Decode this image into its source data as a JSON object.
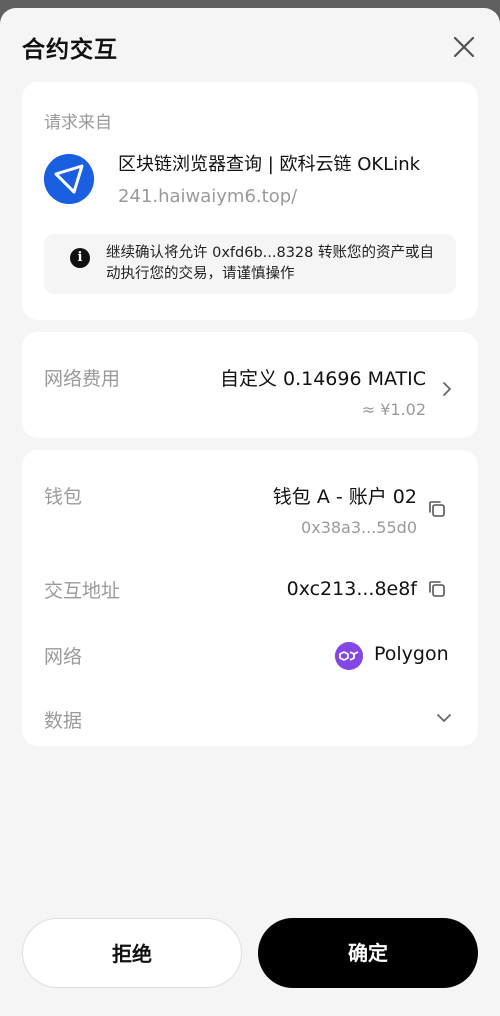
{
  "header": {
    "title": "合约交互"
  },
  "request": {
    "label": "请求来自",
    "site_name": "区块链浏览器查询 | 欧科云链 OKLink",
    "site_url": "241.haiwaiym6.top/",
    "notice": "继续确认将允许 0xfd6b...8328 转账您的资产或自动执行您的交易，请谨慎操作"
  },
  "fee": {
    "label": "网络费用",
    "value": "自定义 0.14696 MATIC",
    "fiat": "≈ ¥1.02"
  },
  "details": {
    "wallet_label": "钱包",
    "wallet_value": "钱包 A - 账户 02",
    "wallet_address": "0x38a3...55d0",
    "contract_label": "交互地址",
    "contract_value": "0xc213...8e8f",
    "network_label": "网络",
    "network_value": "Polygon",
    "data_label": "数据"
  },
  "actions": {
    "reject": "拒绝",
    "confirm": "确定"
  },
  "icons": {
    "close": "close-icon",
    "info": "info-icon",
    "site": "oklink-logo-icon",
    "copy": "copy-icon",
    "network": "polygon-icon",
    "chevron_right": "chevron-right-icon",
    "chevron_down": "chevron-down-icon"
  },
  "colors": {
    "site_logo": "#1a5fe0",
    "polygon": "#8247e5",
    "confirm_bg": "#000000"
  }
}
